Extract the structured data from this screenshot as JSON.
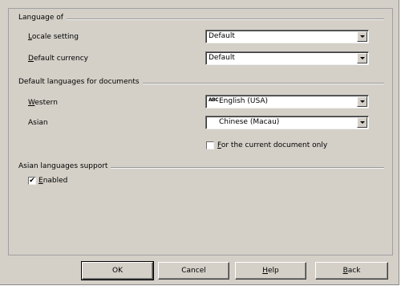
{
  "language_of": {
    "title": "Language of",
    "locale_label": "Locale setting",
    "locale_value": "Default",
    "currency_label": "Default currency",
    "currency_value": "Default"
  },
  "default_languages": {
    "title": "Default languages for documents",
    "western_label": "Western",
    "western_value": "English (USA)",
    "western_badge": "ABC",
    "asian_label": "Asian",
    "asian_value": "Chinese (Macau)",
    "current_doc_label": "For the current document only",
    "current_doc_checked": false
  },
  "asian_support": {
    "title": "Asian languages support",
    "enabled_label": "Enabled",
    "enabled_checked": true,
    "check_mark": "✔"
  },
  "buttons": {
    "ok": "OK",
    "cancel": "Cancel",
    "help": "Help",
    "back": "Back"
  }
}
